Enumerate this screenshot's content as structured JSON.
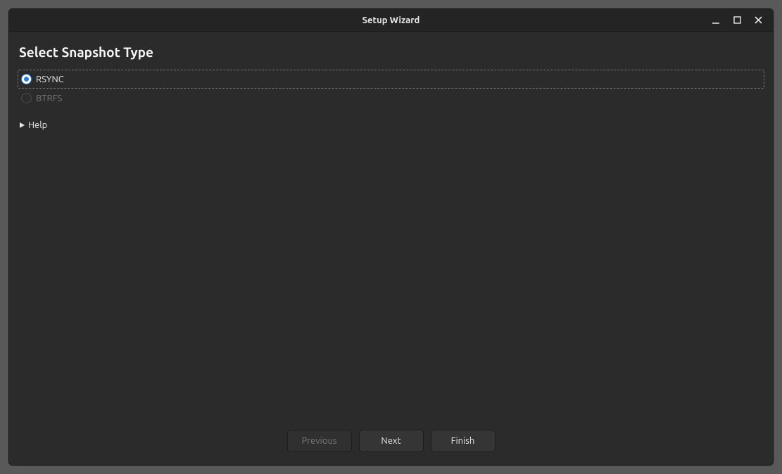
{
  "window": {
    "title": "Setup Wizard"
  },
  "page": {
    "heading": "Select Snapshot Type"
  },
  "options": {
    "rsync": {
      "label": "RSYNC"
    },
    "btrfs": {
      "label": "BTRFS"
    }
  },
  "help": {
    "label": "Help"
  },
  "buttons": {
    "previous": "Previous",
    "next": "Next",
    "finish": "Finish"
  }
}
